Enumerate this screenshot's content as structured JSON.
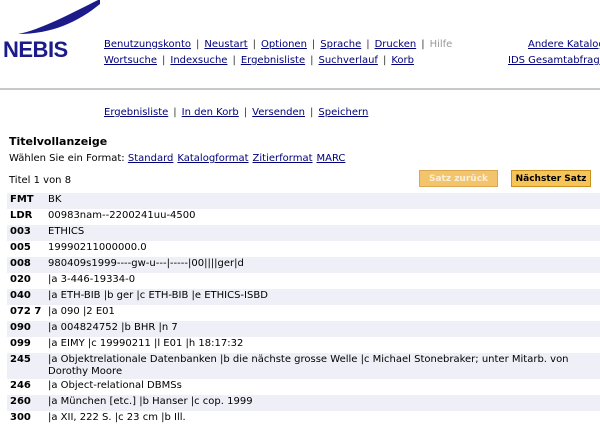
{
  "header": {
    "logo_text": "NEBIS",
    "nav1": [
      {
        "label": "Benutzungskonto",
        "enabled": true
      },
      {
        "label": "Neustart",
        "enabled": true
      },
      {
        "label": "Optionen",
        "enabled": true
      },
      {
        "label": "Sprache",
        "enabled": true
      },
      {
        "label": "Drucken",
        "enabled": true
      },
      {
        "label": "Hilfe",
        "enabled": false
      }
    ],
    "nav2": [
      {
        "label": "Wortsuche"
      },
      {
        "label": "Indexsuche"
      },
      {
        "label": "Ergebnisliste"
      },
      {
        "label": "Suchverlauf"
      },
      {
        "label": "Korb"
      }
    ],
    "right1": "Andere Katalog",
    "right2": "IDS Gesamtabfrag"
  },
  "actions": [
    "Ergebnisliste",
    "In den Korb",
    "Versenden",
    "Speichern"
  ],
  "title": "Titelvollanzeige",
  "format": {
    "prompt": "Wählen Sie ein Format:",
    "options": [
      "Standard",
      "Katalogformat",
      "Zitierformat",
      "MARC"
    ]
  },
  "count": "Titel 1 von 8",
  "buttons": {
    "prev": "Satz zurück",
    "next": "Nächster Satz"
  },
  "colors": {
    "link": "#00007a",
    "logo": "#1b1b8a",
    "button": "#f7c45a",
    "row_alt": "#efeff7"
  },
  "records": [
    {
      "tag": "FMT",
      "value": "BK"
    },
    {
      "tag": "LDR",
      "value": "00983nam--2200241uu-4500"
    },
    {
      "tag": "003",
      "value": "ETHICS"
    },
    {
      "tag": "005",
      "value": "19990211000000.0"
    },
    {
      "tag": "008",
      "value": "980409s1999----gw-u---|-----|00||||ger|d"
    },
    {
      "tag": "020",
      "value": "|a 3-446-19334-0"
    },
    {
      "tag": "040",
      "value": "|a ETH-BIB |b ger |c ETH-BIB |e ETHICS-ISBD"
    },
    {
      "tag": "072 7",
      "value": "|a 090 |2 E01"
    },
    {
      "tag": "090",
      "value": "|a 004824752 |b BHR |n 7"
    },
    {
      "tag": "099",
      "value": "|a EIMY |c 19990211 |l E01 |h 18:17:32"
    },
    {
      "tag": "245",
      "value": "|a Objektrelationale Datenbanken |b die nächste grosse Welle |c Michael Stonebraker; unter Mitarb. von Dorothy Moore"
    },
    {
      "tag": "246",
      "value": "|a Object-relational DBMSs"
    },
    {
      "tag": "260",
      "value": "|a München [etc.] |b Hanser |c cop. 1999"
    },
    {
      "tag": "300",
      "value": "|a XII, 222 S. |c 23 cm |b Ill."
    }
  ]
}
